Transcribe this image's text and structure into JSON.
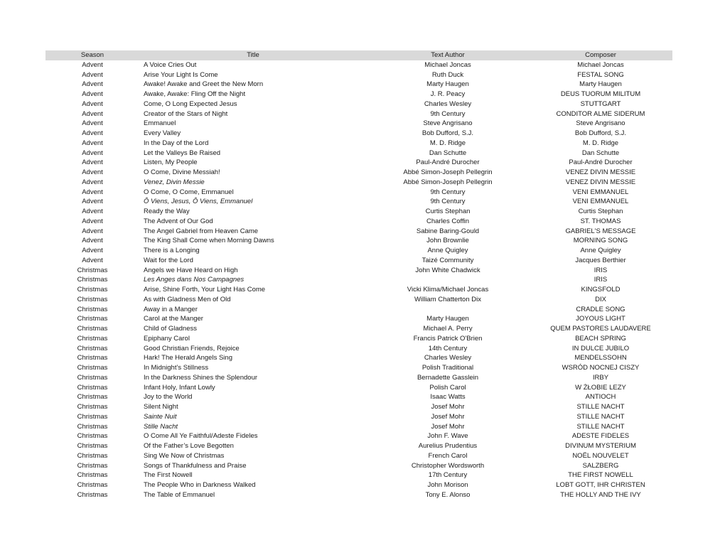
{
  "table": {
    "columns": [
      {
        "key": "season",
        "label": "Season"
      },
      {
        "key": "title",
        "label": "Title"
      },
      {
        "key": "author",
        "label": "Text Author"
      },
      {
        "key": "composer",
        "label": "Composer"
      }
    ],
    "header_background": "#d9d9d9",
    "rows": [
      {
        "season": "Advent",
        "title": "A Voice Cries Out",
        "author": "Michael Joncas",
        "composer": "Michael Joncas",
        "italic_title": false
      },
      {
        "season": "Advent",
        "title": "Arise Your Light Is Come",
        "author": "Ruth Duck",
        "composer": "FESTAL SONG",
        "italic_title": false
      },
      {
        "season": "Advent",
        "title": "Awake! Awake and Greet the New Morn",
        "author": "Marty Haugen",
        "composer": "Marty Haugen",
        "italic_title": false
      },
      {
        "season": "Advent",
        "title": "Awake, Awake: Fling Off the Night",
        "author": "J. R. Peacy",
        "composer": "DEUS TUORUM MILITUM",
        "italic_title": false
      },
      {
        "season": "Advent",
        "title": "Come, O Long Expected Jesus",
        "author": "Charles Wesley",
        "composer": "STUTTGART",
        "italic_title": false
      },
      {
        "season": "Advent",
        "title": "Creator of the Stars of Night",
        "author": "9th Century",
        "composer": "CONDITOR ALME SIDERUM",
        "italic_title": false
      },
      {
        "season": "Advent",
        "title": "Emmanuel",
        "author": "Steve Angrisano",
        "composer": "Steve Angrisano",
        "italic_title": false
      },
      {
        "season": "Advent",
        "title": "Every Valley",
        "author": "Bob Dufford, S.J.",
        "composer": "Bob Dufford, S.J.",
        "italic_title": false
      },
      {
        "season": "Advent",
        "title": "In the Day of the Lord",
        "author": "M. D. Ridge",
        "composer": "M. D. Ridge",
        "italic_title": false
      },
      {
        "season": "Advent",
        "title": "Let the Valleys Be Raised",
        "author": "Dan Schutte",
        "composer": "Dan Schutte",
        "italic_title": false
      },
      {
        "season": "Advent",
        "title": "Listen, My People",
        "author": "Paul-André Durocher",
        "composer": "Paul-André Durocher",
        "italic_title": false
      },
      {
        "season": "Advent",
        "title": "O Come, Divine Messiah!",
        "author": "Abbé Simon-Joseph Pellegrin",
        "composer": "VENEZ DIVIN MESSIE",
        "italic_title": false
      },
      {
        "season": "Advent",
        "title": "Venez, Divin Messie",
        "author": "Abbé Simon-Joseph Pellegrin",
        "composer": "VENEZ DIVIN MESSIE",
        "italic_title": true
      },
      {
        "season": "Advent",
        "title": "O Come, O Come, Emmanuel",
        "author": "9th Century",
        "composer": "VENI EMMANUEL",
        "italic_title": false
      },
      {
        "season": "Advent",
        "title": "Ô Viens, Jesus, Ô Viens, Emmanuel",
        "author": "9th Century",
        "composer": "VENI EMMANUEL",
        "italic_title": true
      },
      {
        "season": "Advent",
        "title": "Ready the Way",
        "author": "Curtis Stephan",
        "composer": "Curtis Stephan",
        "italic_title": false
      },
      {
        "season": "Advent",
        "title": "The Advent of Our God",
        "author": "Charles Coffin",
        "composer": "ST. THOMAS",
        "italic_title": false
      },
      {
        "season": "Advent",
        "title": "The Angel Gabriel from Heaven Came",
        "author": "Sabine Baring-Gould",
        "composer": "GABRIEL'S MESSAGE",
        "italic_title": false
      },
      {
        "season": "Advent",
        "title": "The King Shall Come when Morning Dawns",
        "author": "John Brownlie",
        "composer": "MORNING SONG",
        "italic_title": false
      },
      {
        "season": "Advent",
        "title": "There is a Longing",
        "author": "Anne Quigley",
        "composer": "Anne Quigley",
        "italic_title": false
      },
      {
        "season": "Advent",
        "title": "Wait for the Lord",
        "author": "Taizé Community",
        "composer": "Jacques Berthier",
        "italic_title": false
      },
      {
        "season": "Christmas",
        "title": "Angels we Have Heard on High",
        "author": "John White Chadwick",
        "composer": "IRIS",
        "italic_title": false
      },
      {
        "season": "Christmas",
        "title": "Les Anges dans Nos Campagnes",
        "author": "",
        "composer": "IRIS",
        "italic_title": true
      },
      {
        "season": "Christmas",
        "title": "Arise, Shine Forth, Your Light Has Come",
        "author": "Vicki Klima/Michael Joncas",
        "composer": "KINGSFOLD",
        "italic_title": false
      },
      {
        "season": "Christmas",
        "title": "As with Gladness Men of Old",
        "author": "William Chatterton Dix",
        "composer": "DIX",
        "italic_title": false
      },
      {
        "season": "Christmas",
        "title": "Away in a Manger",
        "author": "",
        "composer": "CRADLE SONG",
        "italic_title": false
      },
      {
        "season": "Christmas",
        "title": "Carol at the Manger",
        "author": "Marty Haugen",
        "composer": "JOYOUS LIGHT",
        "italic_title": false
      },
      {
        "season": "Christmas",
        "title": "Child of Gladness",
        "author": "Michael A. Perry",
        "composer": "QUEM PASTORES LAUDAVERE",
        "italic_title": false
      },
      {
        "season": "Christmas",
        "title": "Epiphany Carol",
        "author": "Francis Patrick O'Brien",
        "composer": "BEACH SPRING",
        "italic_title": false
      },
      {
        "season": "Christmas",
        "title": "Good Christian Friends, Rejoice",
        "author": "14th Century",
        "composer": "IN DULCE JUBILO",
        "italic_title": false
      },
      {
        "season": "Christmas",
        "title": "Hark! The Herald Angels Sing",
        "author": "Charles Wesley",
        "composer": "MENDELSSOHN",
        "italic_title": false
      },
      {
        "season": "Christmas",
        "title": "In Midnight’s Stillness",
        "author": "Polish Traditional",
        "composer": "WSRÓD NOCNEJ CISZY",
        "italic_title": false
      },
      {
        "season": "Christmas",
        "title": "In the Darkness Shines the Splendour",
        "author": "Bernadette Gasslein",
        "composer": "IRBY",
        "italic_title": false
      },
      {
        "season": "Christmas",
        "title": "Infant Holy, Infant Lowly",
        "author": "Polish Carol",
        "composer": "W ŻŁOBIE LEZY",
        "italic_title": false
      },
      {
        "season": "Christmas",
        "title": "Joy to the World",
        "author": "Isaac Watts",
        "composer": "ANTIOCH",
        "italic_title": false
      },
      {
        "season": "Christmas",
        "title": "Silent Night",
        "author": "Josef Mohr",
        "composer": "STILLE NACHT",
        "italic_title": false
      },
      {
        "season": "Christmas",
        "title": "Sainte Nuit",
        "author": "Josef Mohr",
        "composer": "STILLE NACHT",
        "italic_title": true
      },
      {
        "season": "Christmas",
        "title": "Stille Nacht",
        "author": "Josef Mohr",
        "composer": "STILLE NACHT",
        "italic_title": true
      },
      {
        "season": "Christmas",
        "title": "O Come All Ye Faithful/Adeste Fideles",
        "author": "John F. Wave",
        "composer": "ADESTE FIDELES",
        "italic_title": false
      },
      {
        "season": "Christmas",
        "title": "Of the Father’s Love Begotten",
        "author": "Aurelius Prudentius",
        "composer": "DIVINUM MYSTERIUM",
        "italic_title": false
      },
      {
        "season": "Christmas",
        "title": "Sing We Now of Christmas",
        "author": "French Carol",
        "composer": "NOËL NOUVELET",
        "italic_title": false
      },
      {
        "season": "Christmas",
        "title": "Songs of Thankfulness and Praise",
        "author": "Christopher Wordsworth",
        "composer": "SALZBERG",
        "italic_title": false
      },
      {
        "season": "Christmas",
        "title": "The First Nowell",
        "author": "17th Century",
        "composer": "THE FIRST NOWELL",
        "italic_title": false
      },
      {
        "season": "Christmas",
        "title": "The People Who in Darkness Walked",
        "author": "John Morison",
        "composer": "LOBT GOTT, IHR CHRISTEN",
        "italic_title": false
      },
      {
        "season": "Christmas",
        "title": "The Table of Emmanuel",
        "author": "Tony E. Alonso",
        "composer": "THE HOLLY AND THE IVY",
        "italic_title": false
      }
    ]
  }
}
